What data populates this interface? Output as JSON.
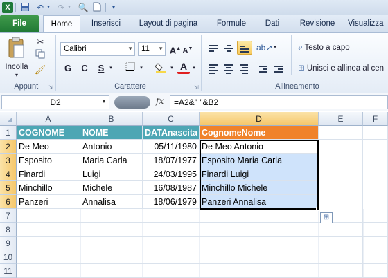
{
  "app": {
    "logo_letter": "X",
    "colors": {
      "accent_green": "#217a35",
      "header_teal": "#4da6b4",
      "header_orange": "#f0822a",
      "selection": "#cfe3fb"
    }
  },
  "qat": {
    "icons": [
      "excel-icon",
      "save-icon",
      "undo-icon",
      "redo-icon",
      "print-preview-icon",
      "new-document-icon",
      "customize-icon"
    ]
  },
  "tabs": [
    "File",
    "Home",
    "Inserisci",
    "Layout di pagina",
    "Formule",
    "Dati",
    "Revisione",
    "Visualizza"
  ],
  "ribbon": {
    "clipboard": {
      "paste_label": "Incolla",
      "group_label": "Appunti"
    },
    "font": {
      "font_name": "Calibri",
      "font_size": "11",
      "group_label": "Carattere",
      "bold": "G",
      "italic": "C",
      "underline": "S",
      "grow": "A",
      "shrink": "A",
      "color_letter": "A"
    },
    "alignment": {
      "wrap_text": "Testo a capo",
      "merge_center": "Unisci e allinea al cen",
      "group_label": "Allineamento"
    }
  },
  "formula_bar": {
    "name_box": "D2",
    "fx": "fx",
    "formula": "=A2&\" \"&B2"
  },
  "grid": {
    "columns": [
      "A",
      "B",
      "C",
      "D",
      "E",
      "F"
    ],
    "rows": [
      "1",
      "2",
      "3",
      "4",
      "5",
      "6",
      "7",
      "8",
      "9",
      "10",
      "11"
    ],
    "header_row": [
      "COGNOME",
      "NOME",
      "DATAnascita",
      "CognomeNome"
    ],
    "data": [
      [
        "De Meo",
        "Antonio",
        "05/11/1980",
        "De Meo Antonio"
      ],
      [
        "Esposito",
        "Maria Carla",
        "18/07/1977",
        "Esposito Maria Carla"
      ],
      [
        "Finardi",
        "Luigi",
        "24/03/1995",
        "Finardi Luigi"
      ],
      [
        "Minchillo",
        "Michele",
        "16/08/1987",
        "Minchillo Michele"
      ],
      [
        "Panzeri",
        "Annalisa",
        "18/06/1979",
        "Panzeri Annalisa"
      ]
    ],
    "selected_range": "D2:D6"
  }
}
